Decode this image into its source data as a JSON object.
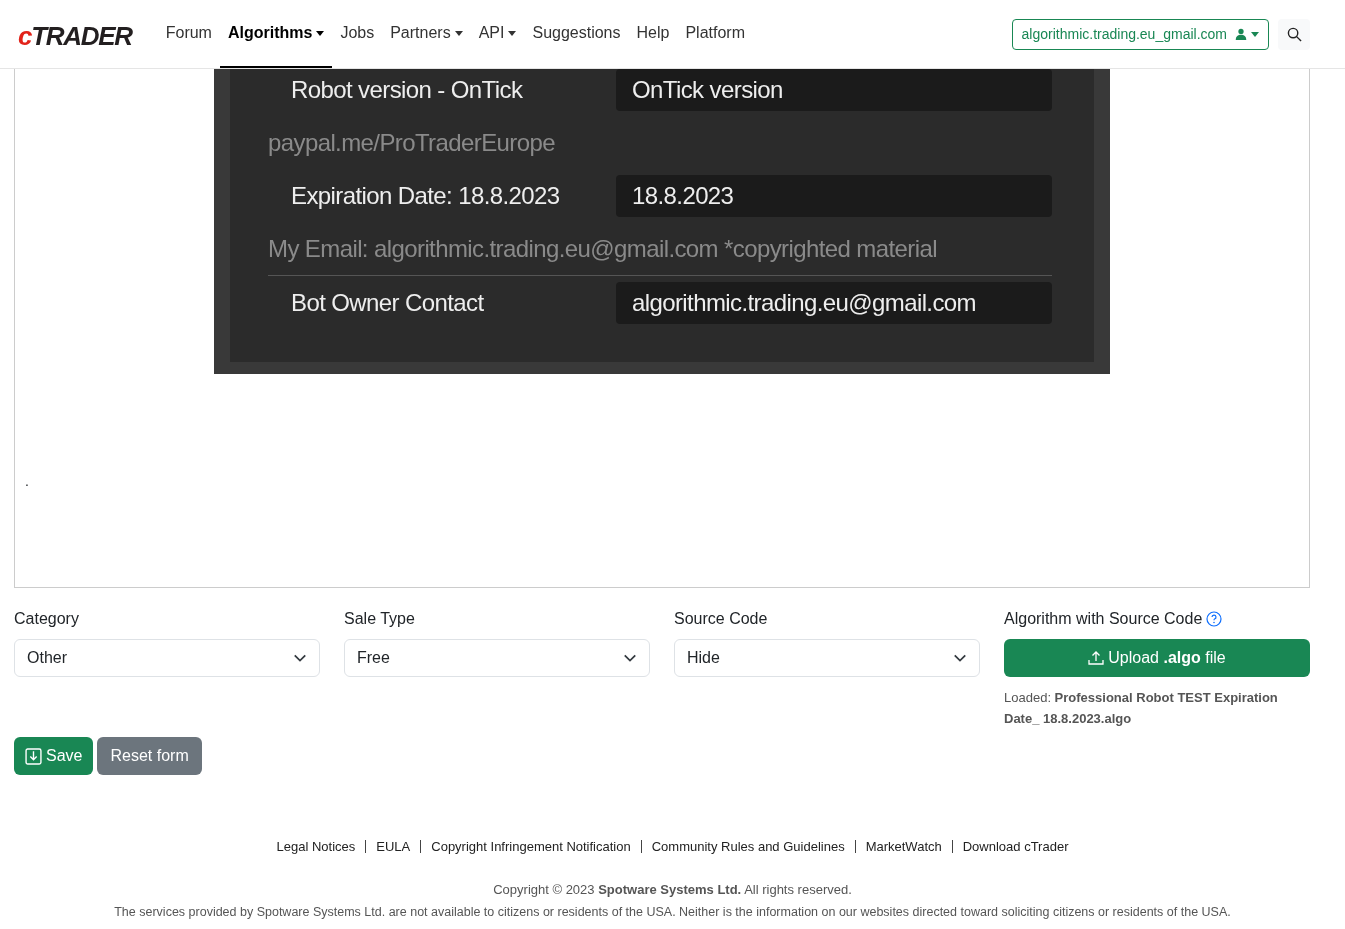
{
  "header": {
    "logo": {
      "letter": "c",
      "rest": "TRADER"
    },
    "nav": [
      {
        "label": "Forum",
        "selected": false,
        "dropdown": false
      },
      {
        "label": "Algorithms",
        "selected": true,
        "dropdown": true
      },
      {
        "label": "Jobs",
        "selected": false,
        "dropdown": false
      },
      {
        "label": "Partners",
        "selected": false,
        "dropdown": true
      },
      {
        "label": "API",
        "selected": false,
        "dropdown": true
      },
      {
        "label": "Suggestions",
        "selected": false,
        "dropdown": false
      },
      {
        "label": "Help",
        "selected": false,
        "dropdown": false
      },
      {
        "label": "Platform",
        "selected": false,
        "dropdown": false
      }
    ],
    "account": "algorithmic.trading.eu_gmail.com"
  },
  "editor": {
    "screenshot_rows": [
      {
        "kind": "field",
        "label": "Robot version - OnTick",
        "value": "OnTick version"
      },
      {
        "kind": "note",
        "text": "paypal.me/ProTraderEurope"
      },
      {
        "kind": "field",
        "label": "Expiration Date: 18.8.2023",
        "value": "18.8.2023"
      },
      {
        "kind": "note_ruled",
        "text": "My Email: algorithmic.trading.eu@gmail.com *copyrighted material"
      },
      {
        "kind": "field",
        "label": "Bot Owner Contact",
        "value": "algorithmic.trading.eu@gmail.com"
      }
    ],
    "trailing_text": "."
  },
  "form": {
    "selects": [
      {
        "label": "Category",
        "value": "Other"
      },
      {
        "label": "Sale Type",
        "value": "Free"
      },
      {
        "label": "Source Code",
        "value": "Hide"
      }
    ],
    "upload": {
      "label": "Algorithm with Source Code",
      "button": "Upload **.algo** file",
      "loaded": "Loaded: **Professional Robot TEST Expiration Date_ 18.8.2023.algo**"
    },
    "buttons": [
      {
        "kind": "save",
        "label": "Save"
      },
      {
        "kind": "reset",
        "label": "Reset form"
      }
    ]
  },
  "footer": {
    "links": [
      "Legal Notices",
      "EULA",
      "Copyright Infringement Notification",
      "Community Rules and Guidelines",
      "MarketWatch",
      "Download cTrader"
    ],
    "copyright": "Copyright © 2023 **Spotware Systems Ltd.** All rights reserved.",
    "disclaimer": "The services provided by Spotware Systems Ltd. are not available to citizens or residents of the USA. Neither is the information on our websites directed toward soliciting citizens or residents of the USA."
  }
}
